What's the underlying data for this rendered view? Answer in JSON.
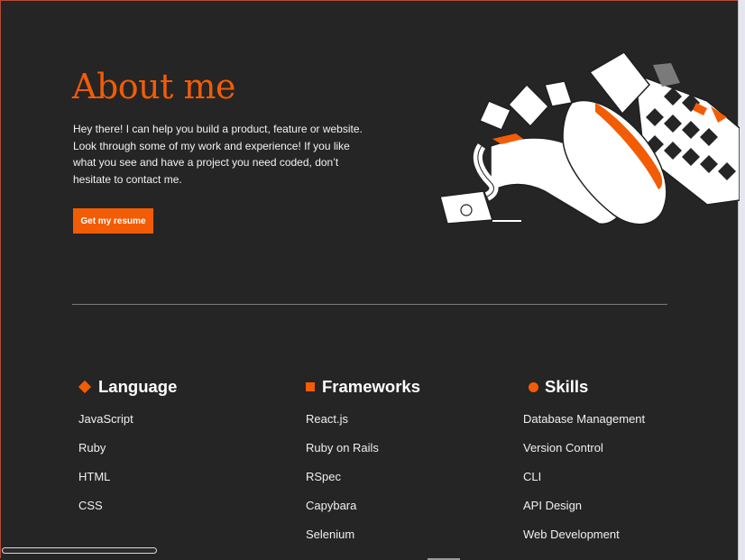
{
  "about": {
    "title": "About me",
    "text": "Hey there! I can help you build a product, feature or website. Look through some of my work and experience! If you like what you see and have a project you need coded, don’t hesitate to contact me.",
    "resume_label": "Get my resume"
  },
  "columns": [
    {
      "title": "Language",
      "marker": "diamond",
      "items": [
        "JavaScript",
        "Ruby",
        "HTML",
        "CSS"
      ]
    },
    {
      "title": "Frameworks",
      "marker": "square",
      "items": [
        "React.js",
        "Ruby on Rails",
        "RSpec",
        "Capybara",
        "Selenium"
      ]
    },
    {
      "title": "Skills",
      "marker": "circle",
      "items": [
        "Database Management",
        "Version Control",
        "CLI",
        "API Design",
        "Web Development"
      ]
    }
  ],
  "colors": {
    "accent": "#f25c05",
    "background": "#252525",
    "text": "#ffffff"
  },
  "icons": {
    "illustration": "laptop-and-paper-illustration",
    "language_marker": "diamond-icon",
    "frameworks_marker": "square-icon",
    "skills_marker": "circle-icon"
  }
}
